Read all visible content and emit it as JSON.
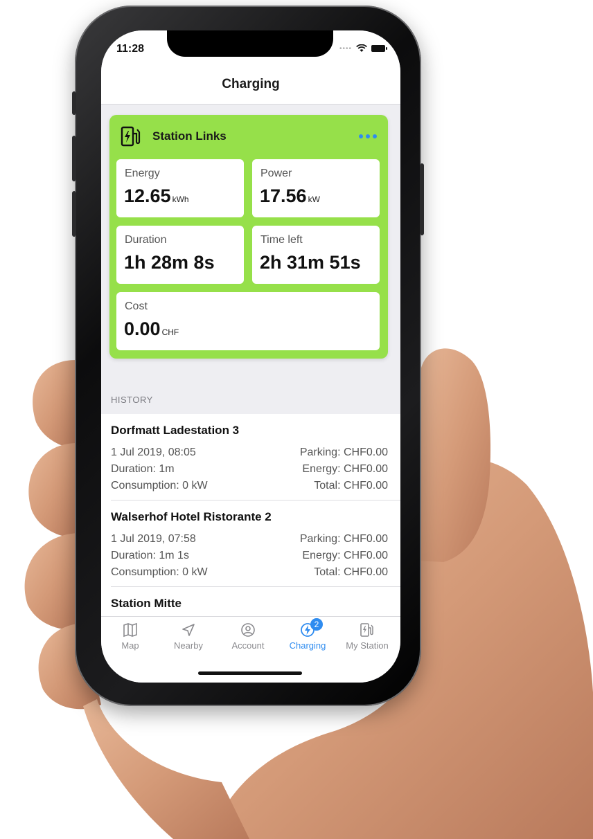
{
  "status_bar": {
    "time": "11:28"
  },
  "nav": {
    "title": "Charging"
  },
  "station_card": {
    "title": "Station Links",
    "energy": {
      "label": "Energy",
      "value": "12.65",
      "unit": "kWh"
    },
    "power": {
      "label": "Power",
      "value": "17.56",
      "unit": "kW"
    },
    "duration": {
      "label": "Duration",
      "value": "1h 28m 8s"
    },
    "time_left": {
      "label": "Time left",
      "value": "2h 31m 51s"
    },
    "cost": {
      "label": "Cost",
      "value": "0.00",
      "unit": "CHF"
    }
  },
  "history": {
    "header": "HISTORY",
    "items": [
      {
        "name": "Dorfmatt Ladestation 3",
        "date": "1 Jul 2019, 08:05",
        "duration": "Duration: 1m",
        "consumption": "Consumption: 0 kW",
        "parking": "Parking: CHF0.00",
        "energy": "Energy: CHF0.00",
        "total": "Total: CHF0.00"
      },
      {
        "name": "Walserhof Hotel Ristorante 2",
        "date": "1 Jul 2019, 07:58",
        "duration": "Duration: 1m 1s",
        "consumption": "Consumption: 0 kW",
        "parking": "Parking: CHF0.00",
        "energy": "Energy: CHF0.00",
        "total": "Total: CHF0.00"
      },
      {
        "name": "Station Mitte"
      }
    ]
  },
  "tabs": [
    {
      "label": "Map",
      "icon": "map-icon"
    },
    {
      "label": "Nearby",
      "icon": "location-arrow-icon"
    },
    {
      "label": "Account",
      "icon": "account-icon"
    },
    {
      "label": "Charging",
      "icon": "charging-bolt-icon",
      "badge": "2",
      "active": true
    },
    {
      "label": "My Station",
      "icon": "charging-station-icon"
    }
  ],
  "colors": {
    "card_green": "#96e04a",
    "accent_blue": "#2f8cf0",
    "phone_frame": "#1c1c1e"
  }
}
